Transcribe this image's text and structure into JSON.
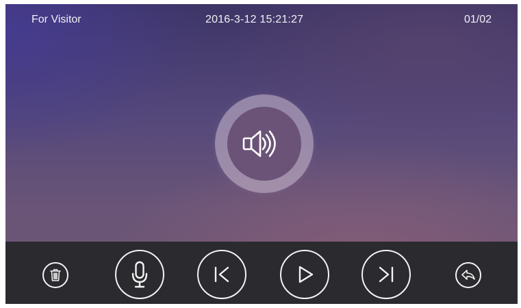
{
  "header": {
    "title": "For Visitor",
    "datetime": "2016-3-12  15:21:27",
    "pager": "01/02"
  },
  "center": {
    "icon": "speaker-volume-icon"
  },
  "controls": [
    {
      "name": "delete-button",
      "icon": "trash-icon"
    },
    {
      "name": "microphone-button",
      "icon": "microphone-icon"
    },
    {
      "name": "previous-button",
      "icon": "skip-previous-icon"
    },
    {
      "name": "play-button",
      "icon": "play-icon"
    },
    {
      "name": "next-button",
      "icon": "skip-next-icon"
    },
    {
      "name": "back-button",
      "icon": "reply-back-icon"
    }
  ],
  "colors": {
    "background_top": "#3d3566",
    "background_bottom": "#6e5670",
    "control_bar": "#2b2a2f",
    "icon_stroke": "#f4f4f4",
    "speaker_ring": "#cdbed2"
  }
}
